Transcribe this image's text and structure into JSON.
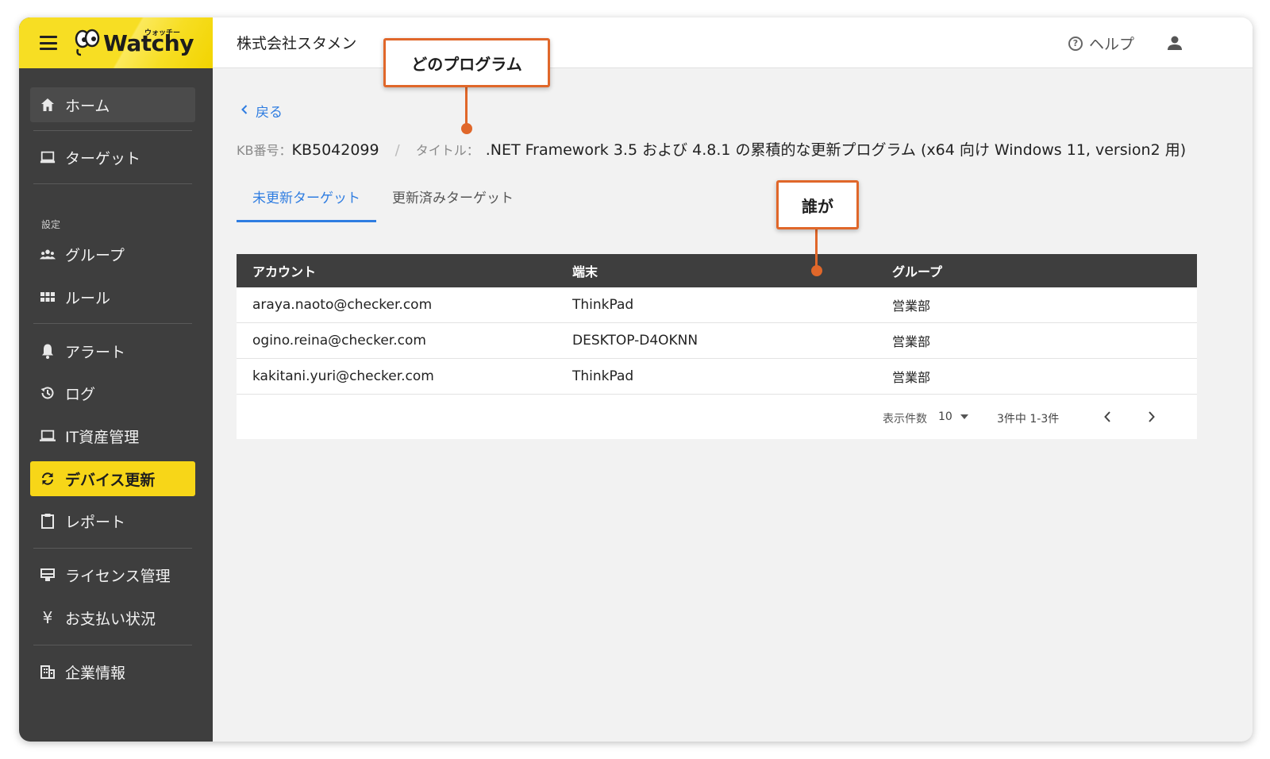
{
  "brand": {
    "logo_text": "Watchy",
    "logo_ruby": "ウォッチー",
    "accent_color": "#f7d618",
    "link_color": "#2f7de1",
    "callout_color": "#e0672a"
  },
  "sidebar": {
    "items": [
      {
        "label": "ホーム",
        "icon": "home-icon"
      },
      {
        "label": "ターゲット",
        "icon": "computer-icon"
      },
      {
        "label": "グループ",
        "icon": "group-icon"
      },
      {
        "label": "ルール",
        "icon": "grid-icon"
      },
      {
        "label": "アラート",
        "icon": "bell-icon"
      },
      {
        "label": "ログ",
        "icon": "history-icon"
      },
      {
        "label": "IT資産管理",
        "icon": "laptop-icon"
      },
      {
        "label": "デバイス更新",
        "icon": "sync-icon"
      },
      {
        "label": "レポート",
        "icon": "clipboard-icon"
      },
      {
        "label": "ライセンス管理",
        "icon": "license-icon"
      },
      {
        "label": "お支払い状況",
        "icon": "yen-icon"
      },
      {
        "label": "企業情報",
        "icon": "building-icon"
      }
    ],
    "section_label": "設定",
    "active": "デバイス更新"
  },
  "header": {
    "company": "株式会社スタメン",
    "help_label": "ヘルプ",
    "help_glyph": "?"
  },
  "main": {
    "back_label": "戻る",
    "kb_label": "KB番号：",
    "kb_value": "KB5042099",
    "separator": "/",
    "title_label": "タイトル：",
    "title_value": ".NET Framework 3.5 および 4.8.1 の累積的な更新プログラム (x64 向け Windows 11, version2 用)",
    "tabs": [
      {
        "label": "未更新ターゲット",
        "active": true
      },
      {
        "label": "更新済みターゲット",
        "active": false
      }
    ]
  },
  "table": {
    "headers": [
      "アカウント",
      "端末",
      "グループ"
    ],
    "rows": [
      [
        "araya.naoto@checker.com",
        "ThinkPad",
        "営業部"
      ],
      [
        "ogino.reina@checker.com",
        "DESKTOP-D4OKNN",
        "営業部"
      ],
      [
        "kakitani.yuri@checker.com",
        "ThinkPad",
        "営業部"
      ]
    ],
    "pager": {
      "per_page_label": "表示件数",
      "per_page_value": "10",
      "range": "3件中 1-3件"
    }
  },
  "callouts": {
    "program": "どのプログラム",
    "who": "誰が"
  }
}
